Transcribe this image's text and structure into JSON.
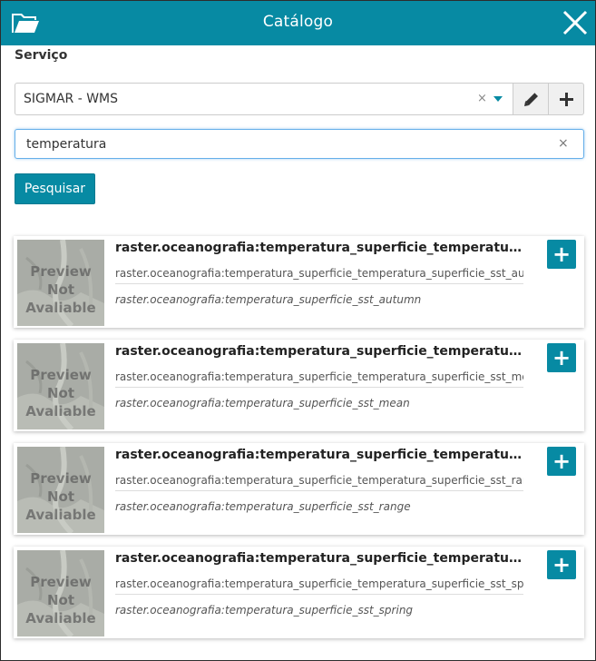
{
  "header": {
    "title": "Catálogo",
    "icons": {
      "open": "folder-open-icon",
      "close": "close-icon"
    },
    "color": "#078aa3"
  },
  "service": {
    "label": "Serviço",
    "selected": "SIGMAR - WMS",
    "clear_symbol": "×",
    "icons": {
      "edit": "pencil-icon",
      "add": "plus-icon"
    }
  },
  "search": {
    "value": "temperatura",
    "clear_symbol": "×",
    "button_label": "Pesquisar"
  },
  "results": [
    {
      "thumb_text": "Preview Not Avaliable",
      "title": "raster.oceanografia:temperatura_superficie_temperatura_superficie_sst_autumn",
      "name": "raster.oceanografia:temperatura_superficie_temperatura_superficie_sst_autumn",
      "description": "raster.oceanografia:temperatura_superficie_sst_autumn",
      "add_symbol": "+"
    },
    {
      "thumb_text": "Preview Not Avaliable",
      "title": "raster.oceanografia:temperatura_superficie_temperatura_superficie_sst_mean",
      "name": "raster.oceanografia:temperatura_superficie_temperatura_superficie_sst_mean",
      "description": "raster.oceanografia:temperatura_superficie_sst_mean",
      "add_symbol": "+"
    },
    {
      "thumb_text": "Preview Not Avaliable",
      "title": "raster.oceanografia:temperatura_superficie_temperatura_superficie_sst_range",
      "name": "raster.oceanografia:temperatura_superficie_temperatura_superficie_sst_range",
      "description": "raster.oceanografia:temperatura_superficie_sst_range",
      "add_symbol": "+"
    },
    {
      "thumb_text": "Preview Not Avaliable",
      "title": "raster.oceanografia:temperatura_superficie_temperatura_superficie_sst_spring",
      "name": "raster.oceanografia:temperatura_superficie_temperatura_superficie_sst_spring",
      "description": "raster.oceanografia:temperatura_superficie_sst_spring",
      "add_symbol": "+"
    }
  ]
}
